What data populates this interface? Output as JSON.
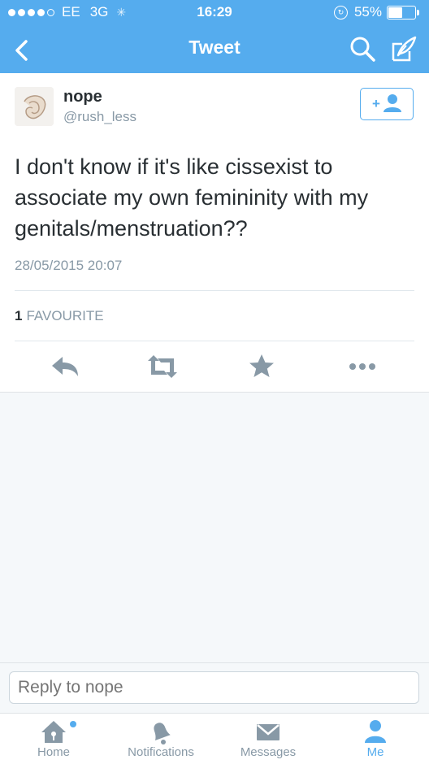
{
  "status_bar": {
    "carrier": "EE",
    "network": "3G",
    "time": "16:29",
    "battery": "55%",
    "battery_level": 0.55,
    "signal_bars": 4,
    "signal_max": 5
  },
  "nav": {
    "title": "Tweet",
    "back_icon": "chevron-left-icon",
    "search_icon": "search-icon",
    "compose_icon": "compose-icon"
  },
  "tweet": {
    "name": "nope",
    "handle": "@rush_less",
    "text": "I don't know if it's like cissexist to associate my own femininity with my genitals/menstruation??",
    "timestamp": "28/05/2015 20:07",
    "favourites_count": "1",
    "favourites_label": "FAVOURITE",
    "follow_icon": "add-user-icon"
  },
  "reply": {
    "placeholder": "Reply to nope"
  },
  "tabs": [
    {
      "label": "Home",
      "icon": "home-icon"
    },
    {
      "label": "Notifications",
      "icon": "bell-icon"
    },
    {
      "label": "Messages",
      "icon": "envelope-icon"
    },
    {
      "label": "Me",
      "icon": "person-icon"
    }
  ],
  "colors": {
    "accent": "#55acee",
    "text": "#292f33",
    "muted": "#8899a6",
    "icon_gray": "#8899a6"
  }
}
